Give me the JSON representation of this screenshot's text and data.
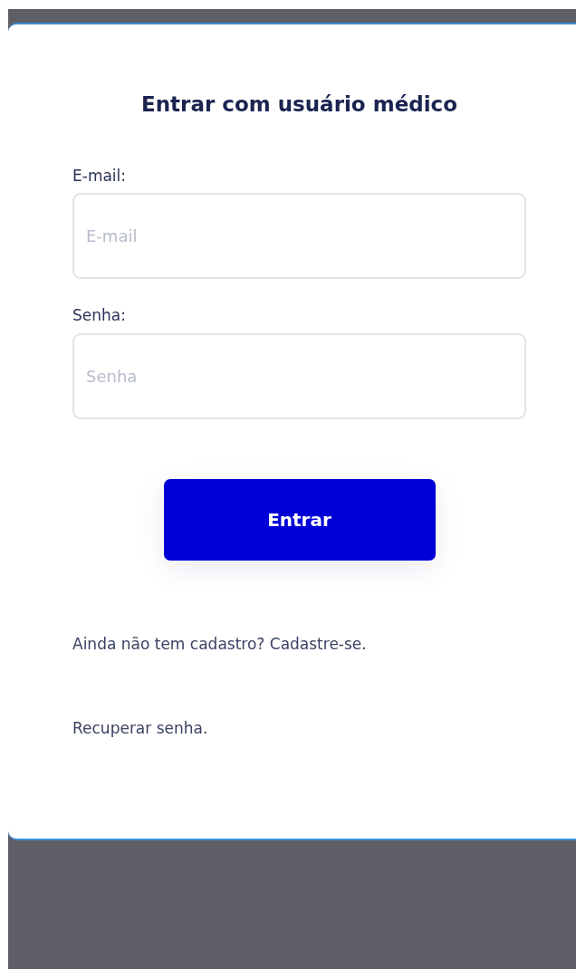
{
  "login_form": {
    "title": "Entrar com usuário médico",
    "fields": [
      {
        "label": "E-mail:",
        "placeholder": "E-mail"
      },
      {
        "label": "Senha:",
        "placeholder": "Senha"
      }
    ],
    "submit_button": "Entrar",
    "links": [
      "Ainda não tem cadastro? Cadastre-se.",
      "Recuperar senha."
    ]
  }
}
